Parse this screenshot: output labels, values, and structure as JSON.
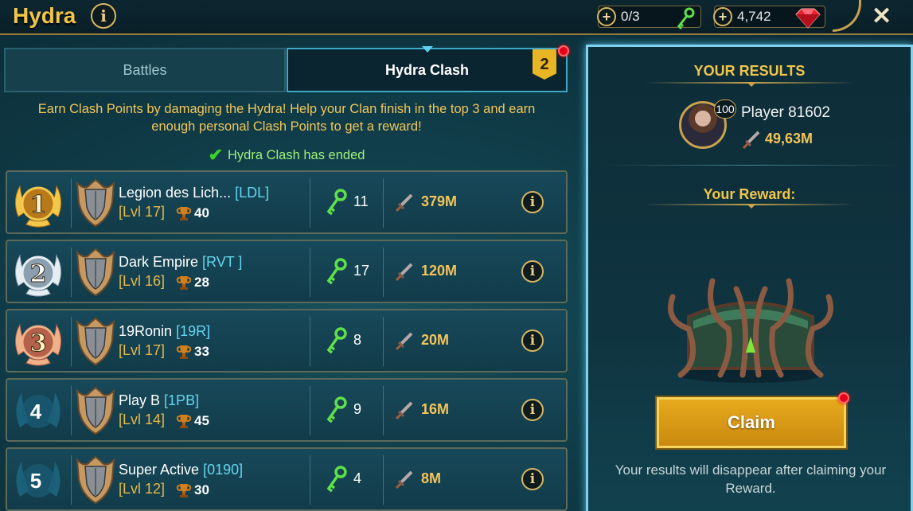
{
  "header": {
    "title": "Hydra",
    "keys": "0/3",
    "gems": "4,742"
  },
  "tabs": [
    {
      "label": "Battles",
      "active": false
    },
    {
      "label": "Hydra Clash",
      "active": true,
      "badge": "2"
    }
  ],
  "description": "Earn Clash Points by damaging the Hydra! Help your Clan finish in the top 3 and earn enough personal Clash Points to get a reward!",
  "status": "Hydra Clash has ended",
  "clans": [
    {
      "rank": "1",
      "name": "Legion des Lich...",
      "tag": "[LDL]",
      "level": "[Lvl 17]",
      "trophies": "40",
      "keys": "11",
      "damage": "379M"
    },
    {
      "rank": "2",
      "name": "Dark Empire",
      "tag": "[RVT ]",
      "level": "[Lvl 16]",
      "trophies": "28",
      "keys": "17",
      "damage": "120M"
    },
    {
      "rank": "3",
      "name": "19Ronin",
      "tag": "[19R]",
      "level": "[Lvl 17]",
      "trophies": "33",
      "keys": "8",
      "damage": "20M"
    },
    {
      "rank": "4",
      "name": "Play B",
      "tag": "[1PB]",
      "level": "[Lvl 14]",
      "trophies": "45",
      "keys": "9",
      "damage": "16M"
    },
    {
      "rank": "5",
      "name": "Super Active",
      "tag": "[0190]",
      "level": "[Lvl 12]",
      "trophies": "30",
      "keys": "4",
      "damage": "8M"
    }
  ],
  "results": {
    "heading": "YOUR RESULTS",
    "player_level": "100",
    "player_name": "Player 81602",
    "player_damage": "49,63M",
    "reward_heading": "Your Reward:",
    "claim_label": "Claim",
    "note": "Your results will disappear after claiming your Reward."
  },
  "colors": {
    "gold": "#f1c54a",
    "accent_blue": "#66d4f0",
    "claim": "#e7a91c",
    "ended_green": "#9ff07a"
  }
}
